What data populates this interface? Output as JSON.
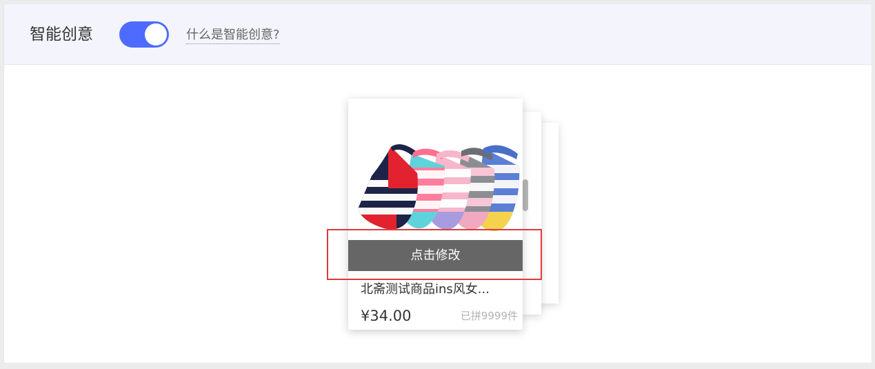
{
  "header": {
    "title": "智能创意",
    "toggle_on": true,
    "help_link": "什么是智能创意?"
  },
  "card": {
    "image_icon": "striped-socks-image",
    "edit_label": "点击修改",
    "product_name": "北斋测试商品ins风女...",
    "price": "¥34.00",
    "group_count": "已拼9999件"
  },
  "colors": {
    "accent": "#4d6cff",
    "edit_bar": "#666666",
    "highlight": "#de3a3a",
    "header_bg": "#f4f5fc"
  }
}
